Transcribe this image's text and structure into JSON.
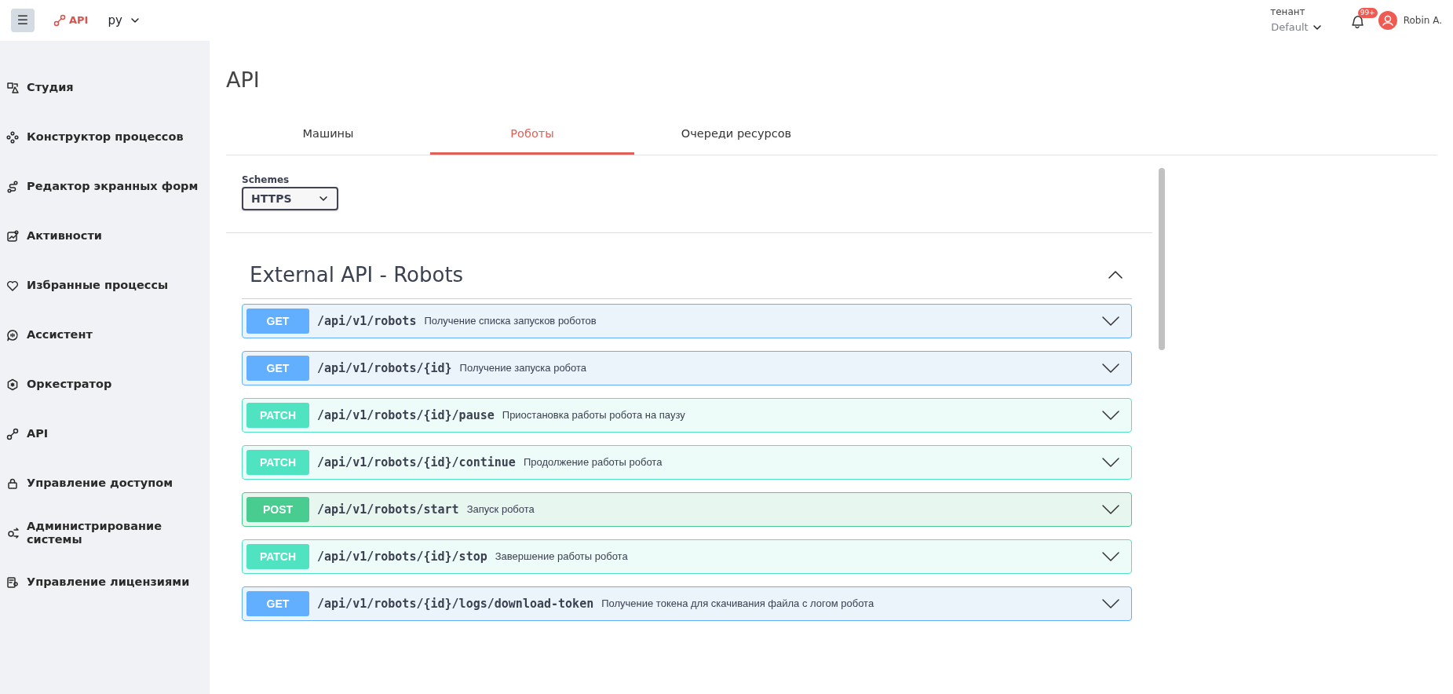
{
  "topbar": {
    "menu_button": "☰",
    "app": "API",
    "language": "ру",
    "tenant_label": "тенант",
    "tenant": "Default",
    "notifications": "99+",
    "user": "Robin A."
  },
  "sidebar": {
    "items": [
      {
        "label": "Студия",
        "kind": "studio"
      },
      {
        "label": "Конструктор процессов",
        "kind": "process"
      },
      {
        "label": "Редактор экранных форм",
        "kind": "forms"
      },
      {
        "label": "Активности",
        "kind": "activity"
      },
      {
        "label": "Избранные процессы",
        "kind": "favorite"
      },
      {
        "label": "Ассистент",
        "kind": "assistant"
      },
      {
        "label": "Оркестратор",
        "kind": "orchestrator"
      },
      {
        "label": "API",
        "kind": "api"
      },
      {
        "label": "Управление доступом",
        "kind": "access"
      },
      {
        "label": "Администрирование системы",
        "kind": "admin"
      },
      {
        "label": "Управление лицензиями",
        "kind": "license"
      }
    ]
  },
  "page": {
    "title": "API"
  },
  "tabs": [
    {
      "label": "Машины",
      "selected": false
    },
    {
      "label": "Роботы",
      "selected": true
    },
    {
      "label": "Очереди ресурсов",
      "selected": false
    }
  ],
  "schemes": {
    "label": "Schemes",
    "value": "HTTPS"
  },
  "section": {
    "title": "External API - Robots",
    "expanded": true,
    "endpoints": [
      {
        "kind": "get",
        "method": "GET",
        "path": "/api/v1/robots",
        "summary": "Получение списка запусков роботов",
        "expanded": false
      },
      {
        "kind": "get",
        "method": "GET",
        "path": "/api/v1/robots/{id}",
        "summary": "Получение запуска робота",
        "expanded": false
      },
      {
        "kind": "patch",
        "method": "PATCH",
        "path": "/api/v1/robots/{id}/pause",
        "summary": "Приостановка работы робота на паузу",
        "expanded": false
      },
      {
        "kind": "patch",
        "method": "PATCH",
        "path": "/api/v1/robots/{id}/continue",
        "summary": "Продолжение работы робота",
        "expanded": false
      },
      {
        "kind": "post",
        "method": "POST",
        "path": "/api/v1/robots/start",
        "summary": "Запуск робота",
        "expanded": false
      },
      {
        "kind": "patch",
        "method": "PATCH",
        "path": "/api/v1/robots/{id}/stop",
        "summary": "Завершение работы робота",
        "expanded": false
      },
      {
        "kind": "get",
        "method": "GET",
        "path": "/api/v1/robots/{id}/logs/download-token",
        "summary": "Получение токена для скачивания файла с логом робота",
        "expanded": false
      }
    ]
  }
}
